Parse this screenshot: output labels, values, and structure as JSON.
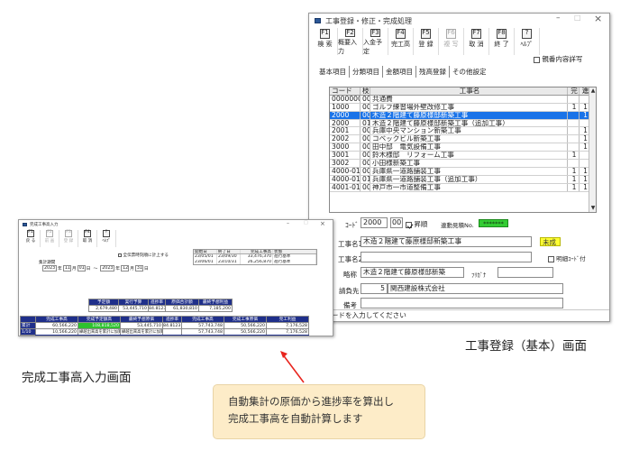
{
  "main_window": {
    "title": "工事登録・修正・完成処理",
    "controls": {
      "minimize": "–",
      "maximize": "□",
      "close": "×"
    },
    "toolbar": [
      {
        "key": "F1",
        "label": "検 索",
        "enabled": true
      },
      {
        "key": "F2",
        "label": "概要入力",
        "enabled": true
      },
      {
        "key": "F3",
        "label": "入金予定",
        "enabled": true
      },
      {
        "key": "F4",
        "label": "完工高",
        "enabled": true
      },
      {
        "key": "F5",
        "label": "登 録",
        "enabled": true
      },
      {
        "key": "F6",
        "label": "複 写",
        "enabled": false
      },
      {
        "key": "F7",
        "label": "取 消",
        "enabled": true
      },
      {
        "key": "F8",
        "label": "終 了",
        "enabled": true
      },
      {
        "key": "?",
        "label": "ﾍﾙﾌﾟ",
        "enabled": true
      }
    ],
    "option_checkbox": {
      "label": "親番内容詳写",
      "checked": false
    },
    "tabs": [
      "基本項目",
      "分類項目",
      "金額項目",
      "残高登録",
      "その他設定"
    ],
    "grid": {
      "headers": [
        "コード",
        "枝",
        "工事名",
        "完",
        "進"
      ],
      "rows": [
        {
          "code": "0000000",
          "eda": "00",
          "name": "共通費",
          "kan": "",
          "shin": "",
          "selected": false
        },
        {
          "code": "1000",
          "eda": "00",
          "name": "ゴルフ練習場外壁改修工事",
          "kan": "1",
          "shin": "1",
          "selected": false
        },
        {
          "code": "2000",
          "eda": "00",
          "name": "木造２階建て藤原様邸新築工事",
          "kan": "",
          "shin": "1",
          "selected": true
        },
        {
          "code": "2000",
          "eda": "01",
          "name": "木造２階建て藤原様邸新築工事（追加工事）",
          "kan": "",
          "shin": "",
          "selected": false
        },
        {
          "code": "2001",
          "eda": "00",
          "name": "兵庫中央マンション新築工事",
          "kan": "",
          "shin": "1",
          "selected": false
        },
        {
          "code": "2002",
          "eda": "00",
          "name": "コベックビル新築工事",
          "kan": "",
          "shin": "1",
          "selected": false
        },
        {
          "code": "3000",
          "eda": "00",
          "name": "田中邸　電気設備工事",
          "kan": "",
          "shin": "1",
          "selected": false
        },
        {
          "code": "3001",
          "eda": "00",
          "name": "鈴木様邸　リフォーム工事",
          "kan": "1",
          "shin": "",
          "selected": false
        },
        {
          "code": "3002",
          "eda": "00",
          "name": "小田様新築工事",
          "kan": "",
          "shin": "",
          "selected": false
        },
        {
          "code": "4000-01",
          "eda": "00",
          "name": "兵庫県一道路舗装工事",
          "kan": "1",
          "shin": "1",
          "selected": false
        },
        {
          "code": "4000-01",
          "eda": "01",
          "name": "兵庫県一道路舗装工事（追加工事）",
          "kan": "1",
          "shin": "1",
          "selected": false
        },
        {
          "code": "4001-01",
          "eda": "00",
          "name": "神戸市一市道整備工事",
          "kan": "1",
          "shin": "1",
          "selected": false
        }
      ]
    },
    "form": {
      "code_label": "ｺｰﾄﾞ",
      "code_value": "2000",
      "eda_value": "00",
      "kyotai_label": "昇順",
      "kyotai_checked": true,
      "renban_label": "連動見積No.",
      "renban_value": "*******",
      "koji_name_label": "工事名1",
      "koji_name_value": "木造２階建て藤原様邸新築工事",
      "status_value": "未成",
      "koji_name2_label": "工事名2",
      "koji_name2_value": "",
      "meisai_label": "明細ｺｰﾄﾞ付",
      "meisai_checked": false,
      "ryaku_label": "略称",
      "ryaku_value": "木造２階建て藤原様邸新築",
      "kana_label": "ﾌﾘｶﾞﾅ",
      "kana_value": "",
      "irai_label": "請負先",
      "irai_code": "5",
      "irai_name": "関西建設株式会社",
      "biko_label": "備考",
      "biko_value": ""
    },
    "status_bar": "見積コードを入力してください"
  },
  "entry_window": {
    "title": "完成工事高入力",
    "controls": {
      "minimize": "–",
      "maximize": "□",
      "close": "×"
    },
    "toolbar": [
      {
        "key": "F1",
        "label": "戻 る",
        "enabled": true
      },
      {
        "key": "F2",
        "label": "前 画",
        "enabled": false
      },
      {
        "key": "F3",
        "label": "登 録",
        "enabled": false
      },
      {
        "key": "F4",
        "label": "取 消",
        "enabled": true
      },
      {
        "key": "?",
        "label": "ﾍﾙﾌﾟ",
        "enabled": true
      }
    ],
    "checkbox_label": "全伝票時刻順に計上する",
    "period_label": "集計期間",
    "period": {
      "from_year": "2023",
      "from_month": "11",
      "from_day": "01",
      "to_year": "2023",
      "to_month": "12",
      "to_day": "31",
      "year_unit": "年",
      "month_unit": "月",
      "day_unit": "日",
      "sep": "～"
    },
    "schedule_headers": [
      "開始日",
      "終了日",
      "完成工事高",
      "状態"
    ],
    "schedule_rows": [
      [
        "23/05/01",
        "23/09/30",
        "33,476,370",
        "進行基準"
      ],
      [
        "23/06/01",
        "23/10/31",
        "26,256,870",
        "進行基準"
      ]
    ],
    "contract_headers": [
      "予定額",
      "実行予算",
      "進捗率",
      "原価合計額",
      "最終予想利益"
    ],
    "contract_values": [
      "2,679,480",
      "53,445,710",
      "84.8123",
      "61,830,810",
      "7,185,200"
    ],
    "summary_headers": [
      "",
      "完成工事高",
      "完成予定額高",
      "最終予想原価",
      "進捗率",
      "完成工事高",
      "完成工事原価",
      "完工利益"
    ],
    "summary_rows": [
      {
        "label": "累計",
        "values": [
          "60,566,220",
          "108,818,520",
          "53,445,710",
          "84.8123",
          "57,743,748",
          "50,566,220",
          "7,176,528"
        ]
      },
      {
        "label": "1/10",
        "values": [
          "10,566,220",
          "繰越出来高を累計に加算",
          "繰越出来高を累計に加算",
          "",
          "57,743,748",
          "50,566,220",
          "7,176,528"
        ]
      },
      {
        "label": "当期",
        "values": [
          "0",
          "",
          "",
          "",
          "0",
          "0",
          "0"
        ]
      }
    ]
  },
  "captions": {
    "main": "工事登録（基本）画面",
    "entry": "完成工事高入力画面"
  },
  "callout": {
    "line1": "自動集計の原価から進捗率を算出し",
    "line2": "完成工事高を自動計算します"
  },
  "colors": {
    "selection": "#1a73e8",
    "navy_header": "#1f2f8a",
    "green_cell": "#2ec22e",
    "callout_bg": "#fdecc8",
    "arrow": "#e8241d"
  }
}
